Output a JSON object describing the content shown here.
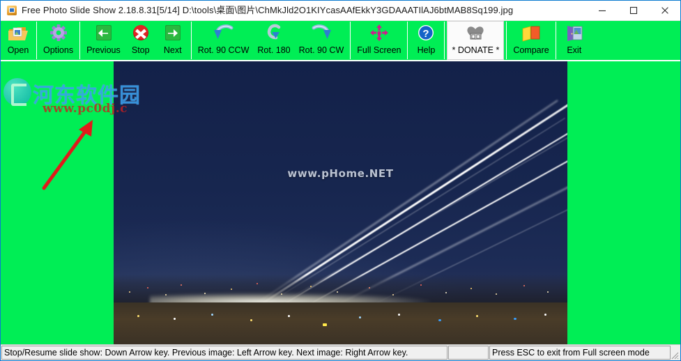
{
  "window": {
    "title": "Free Photo Slide Show 2.18.8.31[5/14] D:\\tools\\桌面\\图片\\ChMkJld2O1KIYcasAAfEkkY3GDAAATIlAJ6btMAB8Sq199.jpg",
    "app_icon": "photo-app-icon",
    "controls": {
      "minimize": "minimize-icon",
      "maximize": "maximize-icon",
      "close": "close-icon"
    }
  },
  "toolbar": {
    "background_color": "#00ee55",
    "buttons": [
      {
        "label": "Open",
        "icon": "open-folder-icon",
        "state": "normal"
      },
      {
        "label": "Options",
        "icon": "gear-icon",
        "state": "normal"
      },
      {
        "label": "Previous",
        "icon": "arrow-left-icon",
        "state": "normal"
      },
      {
        "label": "Stop",
        "icon": "stop-x-icon",
        "state": "normal"
      },
      {
        "label": "Next",
        "icon": "arrow-right-icon",
        "state": "normal"
      },
      {
        "label": "Rot. 90 CCW",
        "icon": "rotate-ccw-icon",
        "state": "normal"
      },
      {
        "label": "Rot. 180",
        "icon": "rotate-180-icon",
        "state": "normal"
      },
      {
        "label": "Rot. 90 CW",
        "icon": "rotate-cw-icon",
        "state": "normal"
      },
      {
        "label": "Full Screen",
        "icon": "fullscreen-arrows-icon",
        "state": "normal"
      },
      {
        "label": "Help",
        "icon": "question-mark-icon",
        "state": "normal"
      },
      {
        "label": "* DONATE *",
        "icon": "heart-donate-icon",
        "state": "hover"
      },
      {
        "label": "Compare",
        "icon": "compare-pages-icon",
        "state": "normal"
      },
      {
        "label": "Exit",
        "icon": "exit-door-icon",
        "state": "normal"
      }
    ]
  },
  "photo": {
    "watermark": "www.pHome.NET",
    "description": "night airport runway with aircraft light trails",
    "sky_color": "#17264f"
  },
  "site_watermark": {
    "chinese": "河东软件园",
    "english": "www.pc0dj.c"
  },
  "annotation": {
    "arrow": "red-arrow-pointing-to-options",
    "color": "#e01b1b"
  },
  "statusbar": {
    "left": "Stop/Resume slide show: Down Arrow key. Previous image: Left Arrow key. Next image: Right Arrow key.",
    "middle": "",
    "right": "Press ESC to exit from Full screen mode"
  }
}
